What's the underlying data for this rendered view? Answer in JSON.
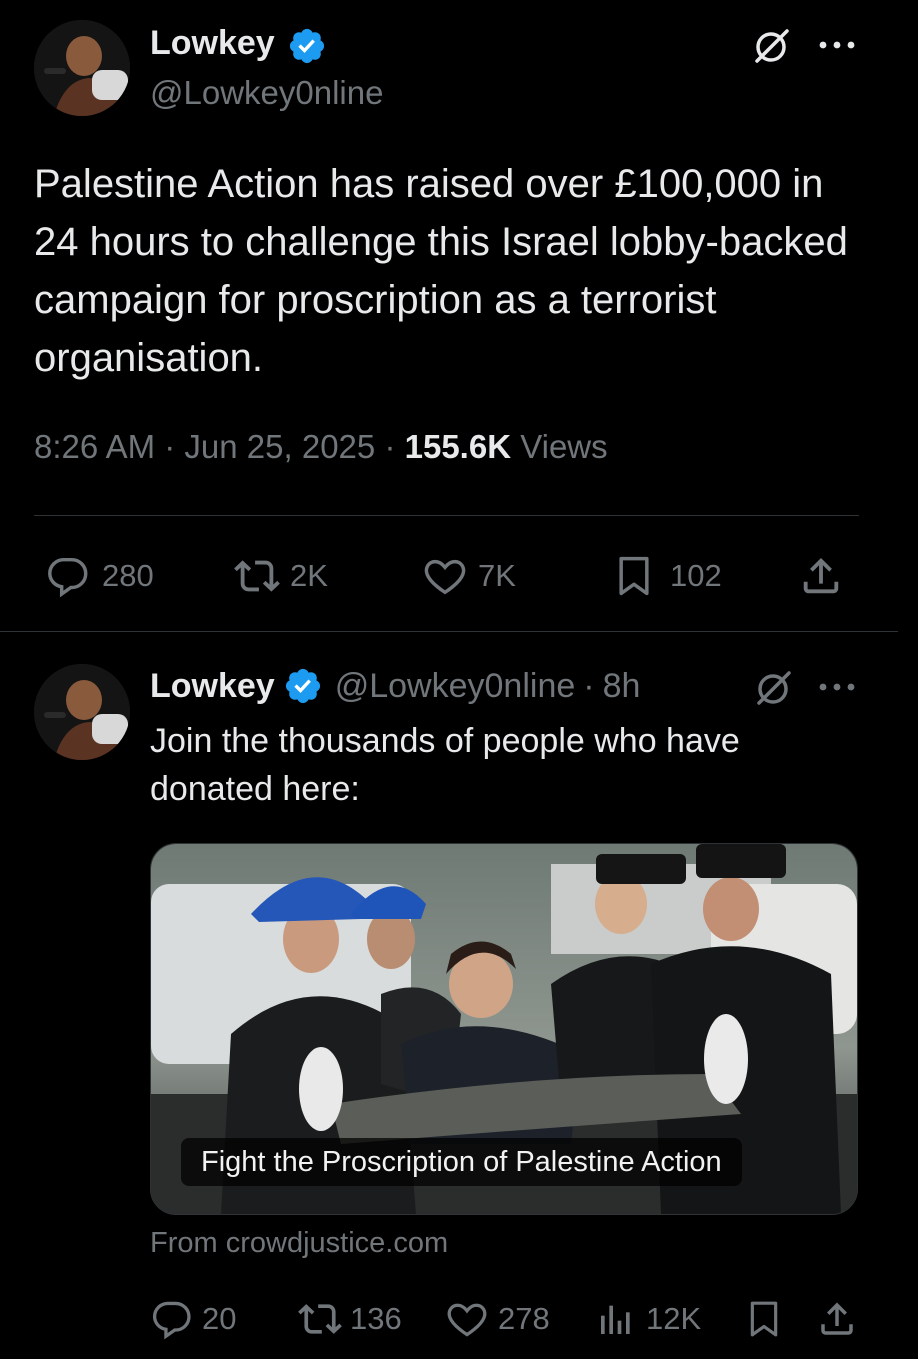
{
  "colors": {
    "background": "#000000",
    "text": "#e7e9ea",
    "muted": "#71767b",
    "verified": "#1d9bf0",
    "divider": "#2f3336"
  },
  "main_tweet": {
    "author_name": "Lowkey",
    "author_handle": "@Lowkey0nline",
    "text": "Palestine Action has raised over £100,000 in 24 hours to challenge this Israel lobby-backed campaign for proscription as a terrorist organisation.",
    "time": "8:26 AM",
    "separator": "·",
    "date": "Jun 25, 2025",
    "views_count": "155.6K",
    "views_label": "Views",
    "replies": "280",
    "reposts": "2K",
    "likes": "7K",
    "bookmarks": "102"
  },
  "reply_tweet": {
    "author_name": "Lowkey",
    "author_handle": "@Lowkey0nline",
    "time_ago": "8h",
    "separator": "·",
    "text": "Join the thousands of people who have donated here:",
    "card_title": "Fight the Proscription of Palestine Action",
    "card_source": "From crowdjustice.com",
    "replies": "20",
    "reposts": "136",
    "likes": "278",
    "views": "12K"
  },
  "icons": [
    "avatar",
    "verified-badge-icon",
    "grok-icon",
    "more-icon",
    "reply-icon",
    "repost-icon",
    "like-icon",
    "bookmark-icon",
    "share-icon",
    "views-icon"
  ]
}
